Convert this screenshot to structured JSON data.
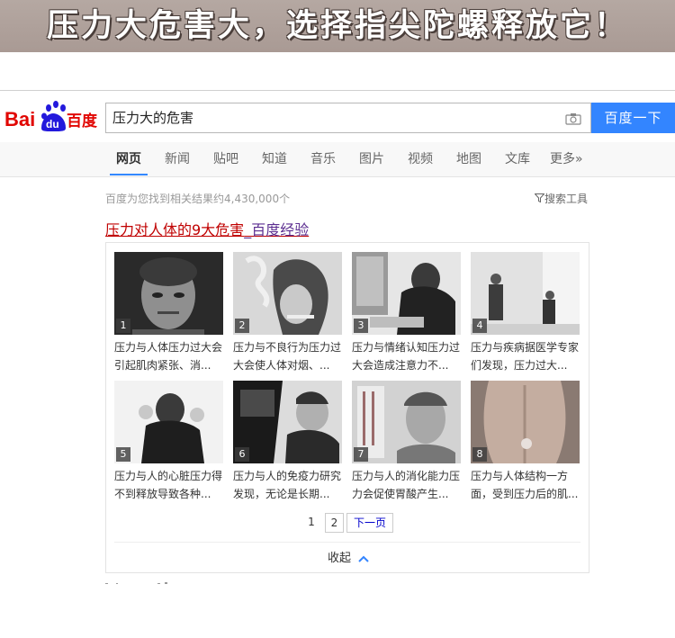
{
  "banner": {
    "text": "压力大危害大，选择指尖陀螺释放它！"
  },
  "logo": {
    "text_bai": "Bai",
    "text_du": "du",
    "text_cn": "百度"
  },
  "search": {
    "query": "压力大的危害",
    "button_label": "百度一下"
  },
  "tabs": [
    {
      "label": "网页"
    },
    {
      "label": "新闻"
    },
    {
      "label": "贴吧"
    },
    {
      "label": "知道"
    },
    {
      "label": "音乐"
    },
    {
      "label": "图片"
    },
    {
      "label": "视频"
    },
    {
      "label": "地图"
    },
    {
      "label": "文库"
    },
    {
      "label": "更多»"
    }
  ],
  "results": {
    "count_text": "百度为您找到相关结果约4,430,000个",
    "tools_label": "搜索工具",
    "title_part1": "压力对人体的9大危害",
    "title_part2": "_百度经验"
  },
  "steps": [
    {
      "num": "1",
      "caption": "压力与人体压力过大会引起肌肉紧张、消..."
    },
    {
      "num": "2",
      "caption": "压力与不良行为压力过大会使人体对烟、..."
    },
    {
      "num": "3",
      "caption": "压力与情绪认知压力过大会造成注意力不..."
    },
    {
      "num": "4",
      "caption": "压力与疾病据医学专家们发现，压力过大..."
    },
    {
      "num": "5",
      "caption": "压力与人的心脏压力得不到释放导致各种..."
    },
    {
      "num": "6",
      "caption": "压力与人的免疫力研究发现，无论是长期..."
    },
    {
      "num": "7",
      "caption": "压力与人的消化能力压力会促使胃酸产生..."
    },
    {
      "num": "8",
      "caption": "压力与人体结构一方面，受到压力后的肌..."
    }
  ],
  "pagination": {
    "page1": "1",
    "page2": "2",
    "next": "下一页"
  },
  "collapse_label": "收起",
  "colors": {
    "accent": "#3385ff",
    "title_red": "#c00000",
    "title_purple": "#5b2d90"
  }
}
